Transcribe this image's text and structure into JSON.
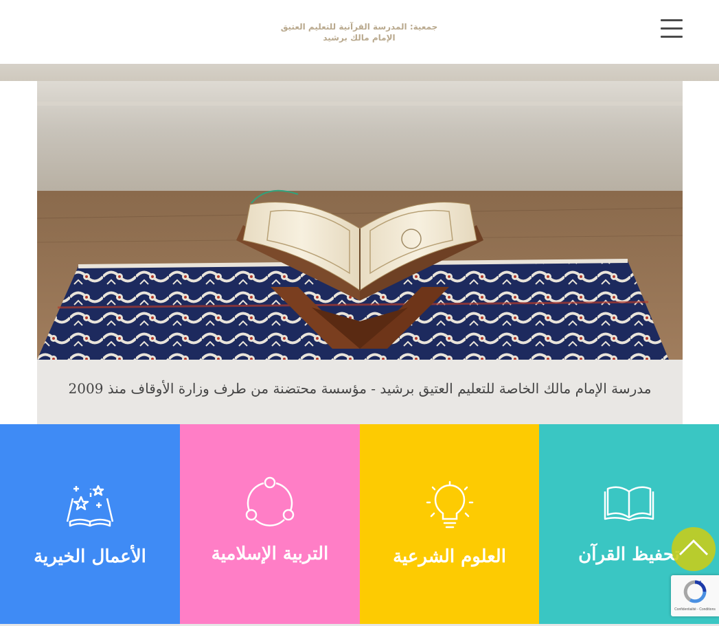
{
  "header": {
    "logo_line1": "جمعية: المدرسة القرآنية للتعليم العتيق",
    "logo_line2": "الإمام مالك برشيد",
    "menu_icon": "hamburger-menu-icon"
  },
  "hero": {
    "image_subject": "open Quran on a wooden stand over a prayer rug",
    "caption": "مدرسة الإمام مالك الخاصة للتعليم العتيق برشيد - مؤسسة محتضنة من طرف وزارة الأوقاف منذ 2009"
  },
  "tiles": [
    {
      "title": "الأعمال الخيرية",
      "icon": "charity-book-stars-icon",
      "color": "#3f8bf5"
    },
    {
      "title": "التربية الإسلامية",
      "icon": "share-nodes-icon",
      "color": "#ff7ec6"
    },
    {
      "title": "العلوم الشرعية",
      "icon": "lightbulb-icon",
      "color": "#fdcb02"
    },
    {
      "title": "تحفيظ القرآن",
      "icon": "open-book-icon",
      "color": "#3ac6c3"
    }
  ],
  "scroll_top": {
    "icon": "chevron-up-icon",
    "color": "#cacd18"
  },
  "recaptcha": {
    "icon": "recaptcha-icon",
    "text": "Confidentialité - Conditions"
  }
}
